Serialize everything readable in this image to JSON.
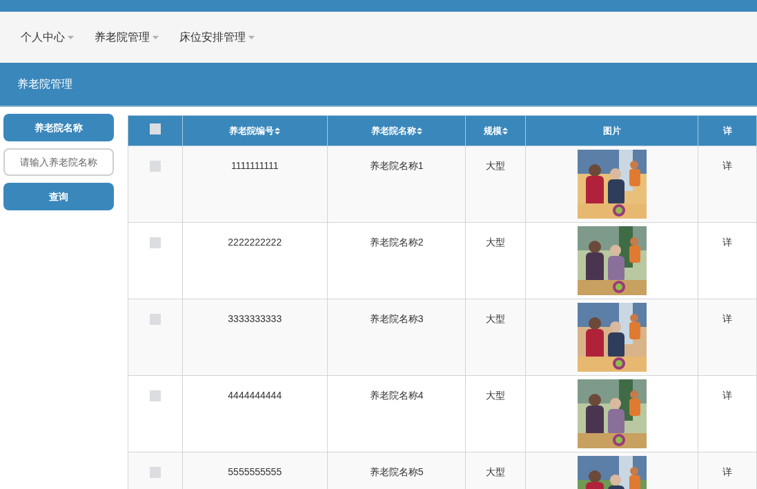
{
  "nav": [
    {
      "label": "个人中心"
    },
    {
      "label": "养老院管理"
    },
    {
      "label": "床位安排管理"
    }
  ],
  "page_title": "养老院管理",
  "search": {
    "label": "养老院名称",
    "placeholder": "请输入养老院名称",
    "button": "查询"
  },
  "table": {
    "select_all_checked": false,
    "columns": [
      {
        "label": "养老院编号",
        "sortable": true
      },
      {
        "label": "养老院名称",
        "sortable": true
      },
      {
        "label": "规模",
        "sortable": true
      },
      {
        "label": "图片",
        "sortable": false
      },
      {
        "label": "详",
        "sortable": false
      }
    ],
    "rows": [
      {
        "checked": false,
        "id": "1111111111",
        "name": "养老院名称1",
        "scale": "大型",
        "detail": "详"
      },
      {
        "checked": false,
        "id": "2222222222",
        "name": "养老院名称2",
        "scale": "大型",
        "detail": "详"
      },
      {
        "checked": false,
        "id": "3333333333",
        "name": "养老院名称3",
        "scale": "大型",
        "detail": "详"
      },
      {
        "checked": false,
        "id": "4444444444",
        "name": "养老院名称4",
        "scale": "大型",
        "detail": "详"
      },
      {
        "checked": false,
        "id": "5555555555",
        "name": "养老院名称5",
        "scale": "大型",
        "detail": "详"
      }
    ]
  }
}
